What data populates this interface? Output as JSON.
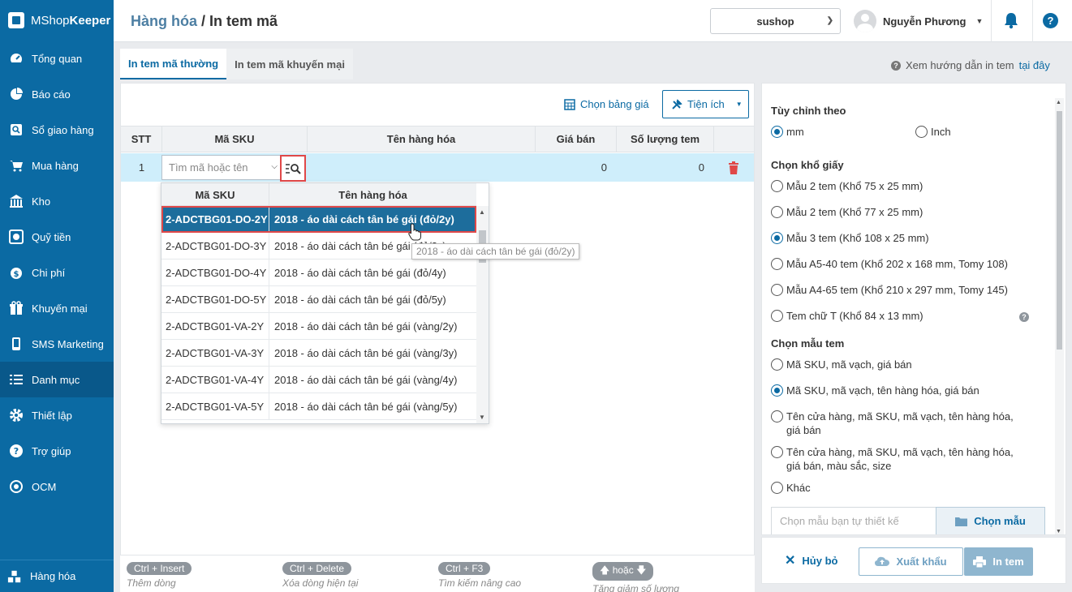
{
  "app": {
    "logo_light": "MShop",
    "logo_bold": "Keeper"
  },
  "sidebar": {
    "items": [
      {
        "label": "Tổng quan",
        "icon": "dashboard-icon"
      },
      {
        "label": "Báo cáo",
        "icon": "pie-chart-icon"
      },
      {
        "label": "Sổ giao hàng",
        "icon": "delivery-book-icon"
      },
      {
        "label": "Mua hàng",
        "icon": "cart-icon"
      },
      {
        "label": "Kho",
        "icon": "warehouse-icon"
      },
      {
        "label": "Quỹ tiền",
        "icon": "money-icon"
      },
      {
        "label": "Chi phí",
        "icon": "expense-icon"
      },
      {
        "label": "Khuyến mại",
        "icon": "gift-icon"
      },
      {
        "label": "SMS Marketing",
        "icon": "phone-icon"
      },
      {
        "label": "Danh mục",
        "icon": "list-icon"
      },
      {
        "label": "Thiết lập",
        "icon": "gear-icon"
      },
      {
        "label": "Trợ giúp",
        "icon": "help-icon"
      },
      {
        "label": "OCM",
        "icon": "ocm-icon"
      }
    ],
    "bottom": {
      "label": "Hàng hóa",
      "icon": "products-icon"
    }
  },
  "header": {
    "crumb": "Hàng hóa",
    "separator": " / ",
    "title": "In tem mã",
    "store": "sushop",
    "user": "Nguyễn Phương"
  },
  "tabs": [
    {
      "label": "In tem mã thường"
    },
    {
      "label": "In tem mã khuyến mại"
    }
  ],
  "guide": {
    "text": "Xem hướng dẫn in tem",
    "link": "tại đây"
  },
  "toolbar": {
    "price_table": "Chọn bảng giá",
    "utility": "Tiện ích"
  },
  "table": {
    "headers": [
      "STT",
      "Mã SKU",
      "Tên hàng hóa",
      "Giá bán",
      "Số lượng tem"
    ],
    "row": {
      "stt": "1",
      "sku_placeholder": "Tìm mã hoặc tên",
      "price": "0",
      "qty": "0"
    }
  },
  "dropdown": {
    "headers": [
      "Mã SKU",
      "Tên hàng hóa"
    ],
    "rows": [
      {
        "sku": "2-ADCTBG01-DO-2Y",
        "name": "2018 - áo dài cách tân bé gái (đỏ/2y)"
      },
      {
        "sku": "2-ADCTBG01-DO-3Y",
        "name": "2018 - áo dài cách tân bé gái (đỏ/3y)"
      },
      {
        "sku": "2-ADCTBG01-DO-4Y",
        "name": "2018 - áo dài cách tân bé gái (đỏ/4y)"
      },
      {
        "sku": "2-ADCTBG01-DO-5Y",
        "name": "2018 - áo dài cách tân bé gái (đỏ/5y)"
      },
      {
        "sku": "2-ADCTBG01-VA-2Y",
        "name": "2018 - áo dài cách tân bé gái (vàng/2y)"
      },
      {
        "sku": "2-ADCTBG01-VA-3Y",
        "name": "2018 - áo dài cách tân bé gái (vàng/3y)"
      },
      {
        "sku": "2-ADCTBG01-VA-4Y",
        "name": "2018 - áo dài cách tân bé gái (vàng/4y)"
      },
      {
        "sku": "2-ADCTBG01-VA-5Y",
        "name": "2018 - áo dài cách tân bé gái (vàng/5y)"
      }
    ],
    "tooltip": "2018 - áo dài cách tân bé gái (đỏ/2y)"
  },
  "shortcuts": [
    {
      "key": "Ctrl + Insert",
      "desc": "Thêm dòng"
    },
    {
      "key": "Ctrl + Delete",
      "desc": "Xóa dòng hiện tại"
    },
    {
      "key": "Ctrl + F3",
      "desc": "Tìm kiếm nâng cao"
    },
    {
      "key": "hoặc",
      "desc": "Tăng giảm số lượng"
    }
  ],
  "settings": {
    "unit_title": "Tùy chỉnh theo",
    "unit_mm": "mm",
    "unit_inch": "Inch",
    "paper_title": "Chọn khổ giấy",
    "papers": [
      "Mẫu 2 tem (Khổ 75 x 25 mm)",
      "Mẫu 2 tem (Khổ 77 x 25 mm)",
      "Mẫu 3 tem (Khổ 108 x 25 mm)",
      "Mẫu A5-40 tem (Khổ 202 x 168 mm, Tomy 108)",
      "Mẫu A4-65 tem (Khổ 210 x 297 mm, Tomy 145)",
      "Tem chữ T (Khổ 84 x 13 mm)"
    ],
    "template_title": "Chọn mẫu tem",
    "templates": [
      "Mã SKU, mã vạch, giá bán",
      "Mã SKU, mã vạch, tên hàng hóa, giá bán",
      "Tên cửa hàng, mã SKU, mã vạch, tên hàng hóa, giá bán",
      "Tên cửa hàng, mã SKU, mã vạch, tên hàng hóa, giá bán, màu sắc, size",
      "Khác"
    ],
    "custom_placeholder": "Chọn mẫu bạn tự thiết kế",
    "custom_button": "Chọn mẫu"
  },
  "actions": {
    "cancel": "Hủy bỏ",
    "export": "Xuất khẩu",
    "print": "In tem"
  }
}
